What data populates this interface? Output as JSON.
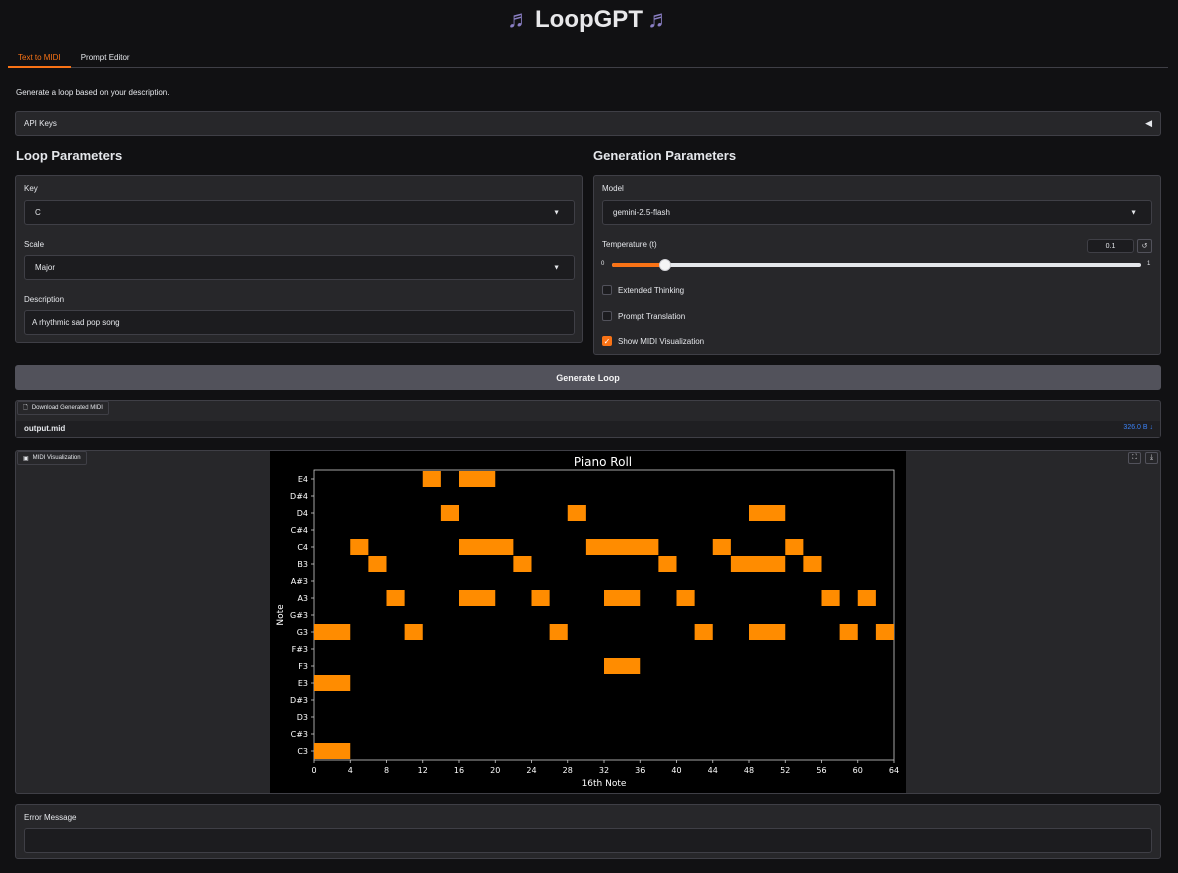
{
  "app": {
    "title": "LoopGPT",
    "title_icon": "music-note-icon",
    "title_glyph": "♬"
  },
  "tabs": [
    {
      "label": "Text to MIDI",
      "active": true
    },
    {
      "label": "Prompt Editor",
      "active": false
    }
  ],
  "description_text": "Generate a loop based on your description.",
  "api_keys": {
    "label": "API Keys",
    "arrow": "◀"
  },
  "loop_params": {
    "title": "Loop Parameters",
    "key_label": "Key",
    "key_value": "C",
    "scale_label": "Scale",
    "scale_value": "Major",
    "description_label": "Description",
    "description_value": "A rhythmic sad pop song"
  },
  "gen_params": {
    "title": "Generation Parameters",
    "model_label": "Model",
    "model_value": "gemini-2.5-flash",
    "temperature_label": "Temperature (t)",
    "temperature_value": "0.1",
    "temperature_min": "0",
    "temperature_max": "1",
    "temperature_fraction": 0.1,
    "reset_glyph": "↺",
    "extended_thinking_label": "Extended Thinking",
    "extended_thinking": false,
    "prompt_translation_label": "Prompt Translation",
    "prompt_translation": false,
    "show_midi_label": "Show MIDI Visualization",
    "show_midi": true
  },
  "generate_button": "Generate Loop",
  "download": {
    "label": "Download Generated MIDI",
    "filename": "output.mid",
    "size": "326.0 B ↓"
  },
  "midi_viz": {
    "label": "MIDI Visualization",
    "fullscreen_glyph": "⛶",
    "download_glyph": "⤓"
  },
  "error": {
    "label": "Error Message",
    "value": ""
  },
  "colors": {
    "accent": "#f97316",
    "note": "#ff8c00",
    "link": "#3b82f6"
  },
  "chart_data": {
    "type": "heatmap",
    "title": "Piano Roll",
    "xlabel": "16th Note",
    "ylabel": "Note",
    "xlim": [
      0,
      64
    ],
    "x_ticks": [
      0,
      4,
      8,
      12,
      16,
      20,
      24,
      28,
      32,
      36,
      40,
      44,
      48,
      52,
      56,
      60,
      64
    ],
    "pitches": [
      "C3",
      "C#3",
      "D3",
      "D#3",
      "E3",
      "F3",
      "F#3",
      "G3",
      "G#3",
      "A3",
      "A#3",
      "B3",
      "C4",
      "C#4",
      "D4",
      "D#4",
      "E4"
    ],
    "notes": [
      {
        "pitch": "C3",
        "start": 0,
        "end": 4
      },
      {
        "pitch": "E3",
        "start": 0,
        "end": 4
      },
      {
        "pitch": "G3",
        "start": 0,
        "end": 4
      },
      {
        "pitch": "C4",
        "start": 4,
        "end": 6
      },
      {
        "pitch": "B3",
        "start": 6,
        "end": 8
      },
      {
        "pitch": "A3",
        "start": 8,
        "end": 10
      },
      {
        "pitch": "G3",
        "start": 10,
        "end": 12
      },
      {
        "pitch": "E4",
        "start": 12,
        "end": 14
      },
      {
        "pitch": "D4",
        "start": 14,
        "end": 16
      },
      {
        "pitch": "E4",
        "start": 16,
        "end": 20
      },
      {
        "pitch": "C4",
        "start": 16,
        "end": 22
      },
      {
        "pitch": "A3",
        "start": 16,
        "end": 20
      },
      {
        "pitch": "B3",
        "start": 22,
        "end": 24
      },
      {
        "pitch": "A3",
        "start": 24,
        "end": 26
      },
      {
        "pitch": "G3",
        "start": 26,
        "end": 28
      },
      {
        "pitch": "D4",
        "start": 28,
        "end": 30
      },
      {
        "pitch": "C4",
        "start": 30,
        "end": 38
      },
      {
        "pitch": "A3",
        "start": 32,
        "end": 36
      },
      {
        "pitch": "F3",
        "start": 32,
        "end": 36
      },
      {
        "pitch": "B3",
        "start": 38,
        "end": 40
      },
      {
        "pitch": "A3",
        "start": 40,
        "end": 42
      },
      {
        "pitch": "G3",
        "start": 42,
        "end": 44
      },
      {
        "pitch": "C4",
        "start": 44,
        "end": 46
      },
      {
        "pitch": "B3",
        "start": 46,
        "end": 52
      },
      {
        "pitch": "D4",
        "start": 48,
        "end": 52
      },
      {
        "pitch": "G3",
        "start": 48,
        "end": 52
      },
      {
        "pitch": "C4",
        "start": 52,
        "end": 54
      },
      {
        "pitch": "B3",
        "start": 54,
        "end": 56
      },
      {
        "pitch": "A3",
        "start": 56,
        "end": 58
      },
      {
        "pitch": "G3",
        "start": 58,
        "end": 60
      },
      {
        "pitch": "A3",
        "start": 60,
        "end": 62
      },
      {
        "pitch": "G3",
        "start": 62,
        "end": 64
      }
    ],
    "grid": false
  }
}
